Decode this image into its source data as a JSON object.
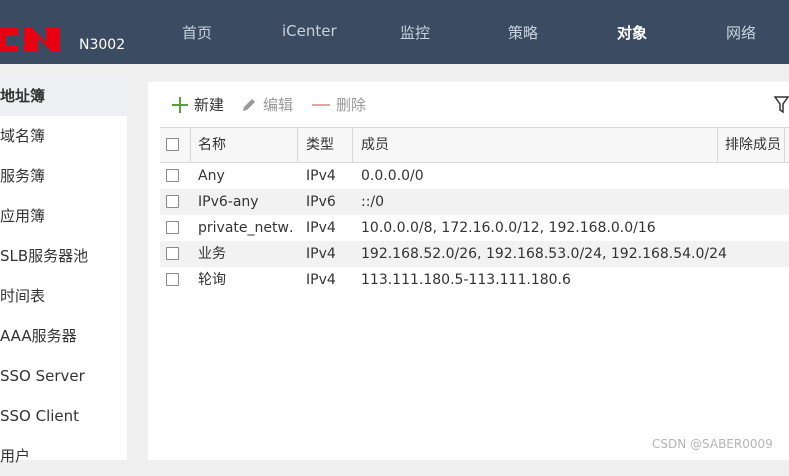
{
  "header": {
    "model": "N3002",
    "nav": [
      {
        "label": "首页"
      },
      {
        "label": "iCenter"
      },
      {
        "label": "监控"
      },
      {
        "label": "策略"
      },
      {
        "label": "对象",
        "active": true
      },
      {
        "label": "网络"
      }
    ]
  },
  "sidebar": {
    "items": [
      {
        "label": "地址簿",
        "active": true
      },
      {
        "label": "域名簿"
      },
      {
        "label": "服务簿"
      },
      {
        "label": "应用簿"
      },
      {
        "label": "SLB服务器池"
      },
      {
        "label": "时间表"
      },
      {
        "label": "AAA服务器"
      },
      {
        "label": "SSO Server"
      },
      {
        "label": "SSO Client"
      },
      {
        "label": "用户"
      }
    ]
  },
  "toolbar": {
    "new_label": "新建",
    "edit_label": "编辑",
    "delete_label": "删除",
    "filter_icon": "filter-icon"
  },
  "table": {
    "columns": [
      "名称",
      "类型",
      "成员",
      "排除成员"
    ],
    "rows": [
      [
        "Any",
        "IPv4",
        "0.0.0.0/0"
      ],
      [
        "IPv6-any",
        "IPv6",
        "::/0"
      ],
      [
        "private_netw…",
        "IPv4",
        "10.0.0.0/8, 172.16.0.0/12, 192.168.0.0/16"
      ],
      [
        "业务",
        "IPv4",
        "192.168.52.0/26, 192.168.53.0/24, 192.168.54.0/24"
      ],
      [
        "轮询",
        "IPv4",
        "113.111.180.5-113.111.180.6"
      ]
    ]
  },
  "watermark": "CSDN @SABER0009",
  "colors": {
    "topbar": "#3b4b61",
    "logo": "#e60012",
    "add_icon": "#52a334",
    "delete_icon": "#e8a0a0"
  }
}
